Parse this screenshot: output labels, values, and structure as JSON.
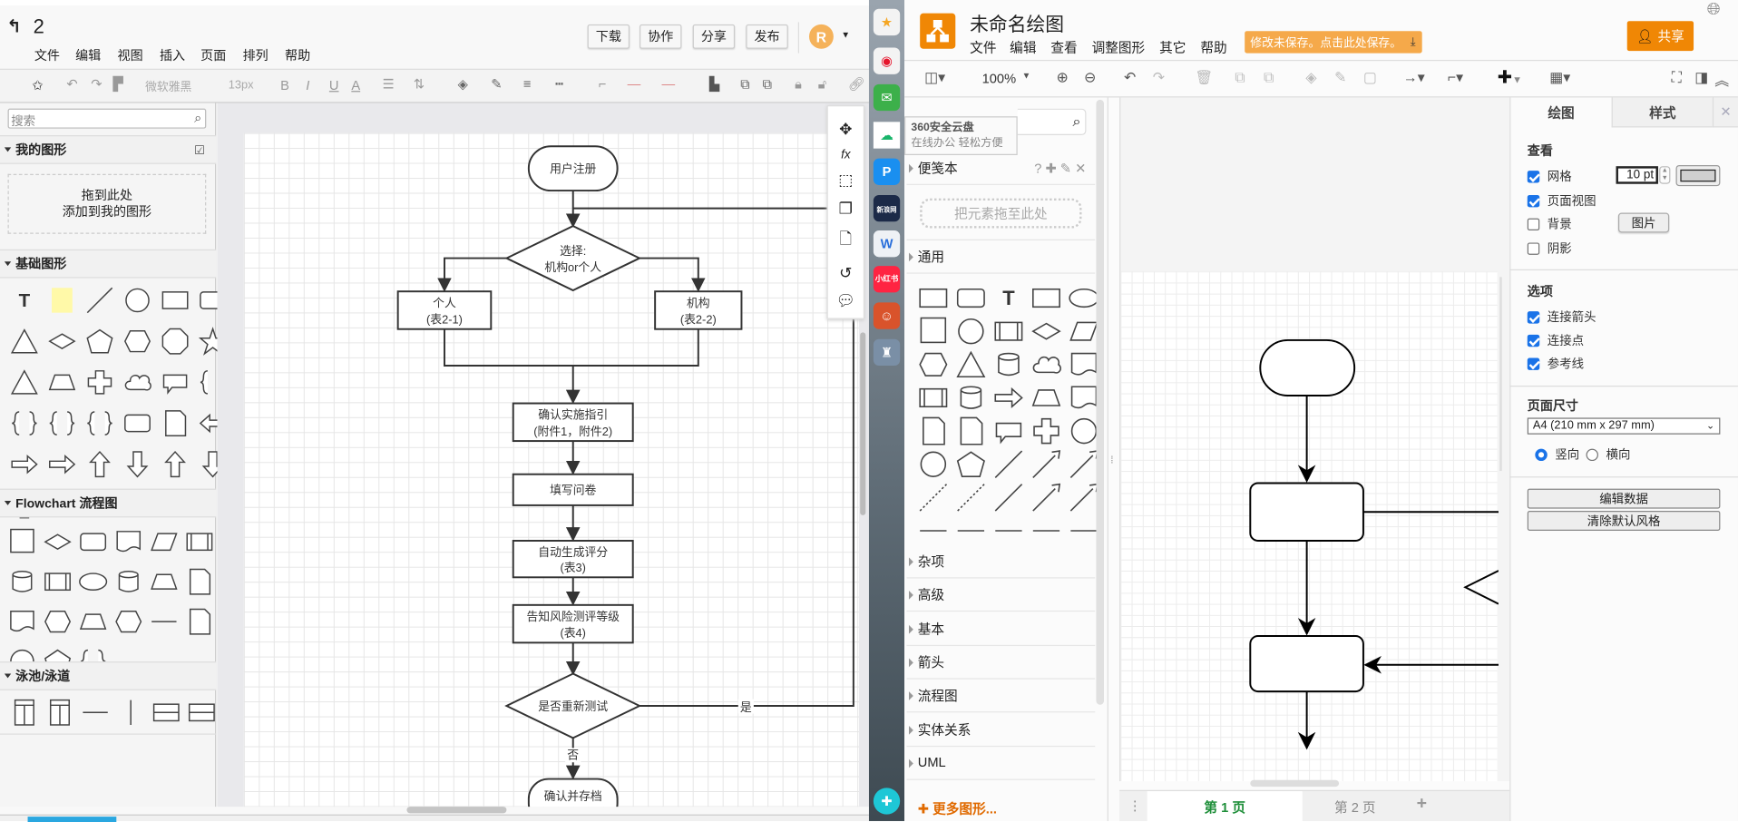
{
  "left_app": {
    "doc_title": "2",
    "menu": [
      "文件",
      "编辑",
      "视图",
      "插入",
      "页面",
      "排列",
      "帮助"
    ],
    "buttons": {
      "download": "下载",
      "collab": "协作",
      "share": "分享",
      "publish": "发布"
    },
    "avatar_letter": "R",
    "toolbar": {
      "font": "微软雅黑",
      "font_size": "13px",
      "bold": "B",
      "italic": "I",
      "underline": "U",
      "font_color": "A"
    },
    "sidebar": {
      "search_placeholder": "搜索",
      "my_shapes": "我的图形",
      "drop_hint_1": "拖到此处",
      "drop_hint_2": "添加到我的图形",
      "basic": "基础图形",
      "flowchart": "Flowchart 流程图",
      "swimlane": "泳池/泳道"
    },
    "flowchart": {
      "start": "用户注册",
      "choice_1": "选择:",
      "choice_2": "机构or个人",
      "personal_1": "个人",
      "personal_2": "(表2-1)",
      "org_1": "机构",
      "org_2": "(表2-2)",
      "guide_1": "确认实施指引",
      "guide_2": "(附件1，附件2)",
      "survey": "填写问卷",
      "score_1": "自动生成评分",
      "score_2": "(表3)",
      "risk_1": "告知风险测评等级",
      "risk_2": "(表4)",
      "retest": "是否重新测试",
      "yes": "是",
      "no": "否",
      "end": "确认并存档"
    }
  },
  "taskbar": {
    "tooltip_title": "360安全云盘",
    "tooltip_sub": "在线办公 轻松方便",
    "icons": [
      "star-icon",
      "weibo-icon",
      "mail-icon",
      "cloud-icon",
      "pdf-icon",
      "news-icon",
      "word-icon",
      "xiaohongshu-icon",
      "game-icon",
      "pubg-icon",
      "plus-app-icon"
    ],
    "news_label": "新浪网",
    "red_label": "小红书"
  },
  "right_app": {
    "title": "未命名绘图",
    "menu": [
      "文件",
      "编辑",
      "查看",
      "调整图形",
      "其它",
      "帮助"
    ],
    "unsaved": "修改未保存。点击此处保存。",
    "share": "共享",
    "zoom": "100%",
    "shapes_panel": {
      "scratchpad": "便笺本",
      "scratch_hint": "把元素拖至此处",
      "general": "通用",
      "text_shape": "Text",
      "sections": [
        "杂项",
        "高级",
        "基本",
        "箭头",
        "流程图",
        "实体关系",
        "UML"
      ],
      "more": "更多图形..."
    },
    "pages": {
      "page1": "第 1 页",
      "page2": "第 2 页"
    },
    "format": {
      "tab_diagram": "绘图",
      "tab_style": "样式",
      "view": "查看",
      "grid": "网格",
      "grid_size": "10 pt",
      "page_view": "页面视图",
      "background": "背景",
      "image_btn": "图片",
      "shadow": "阴影",
      "options": "选项",
      "conn_arrows": "连接箭头",
      "conn_points": "连接点",
      "guides": "参考线",
      "paper_size": "页面尺寸",
      "paper_value": "A4 (210 mm x 297 mm)",
      "portrait": "竖向",
      "landscape": "横向",
      "edit_data": "编辑数据",
      "clear_style": "清除默认风格",
      "checks": {
        "grid": true,
        "page_view": true,
        "background": false,
        "shadow": false,
        "conn_arrows": true,
        "conn_points": true,
        "guides": true
      },
      "orientation": "portrait"
    }
  },
  "colors": {
    "orange": "#f08705",
    "unsaved_bg": "#f5a94a",
    "avatar": "#f5b25a",
    "active_tab_text": "#1f8f3a",
    "check_blue": "#1a73e8"
  }
}
